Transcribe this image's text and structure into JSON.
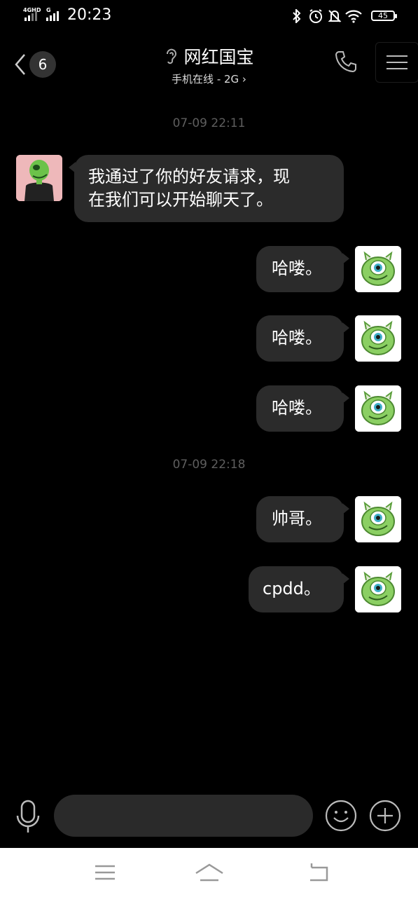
{
  "status_bar": {
    "network_1": "4GHD",
    "network_2": "G",
    "time": "20:23",
    "battery": "45",
    "icons": [
      "bluetooth-icon",
      "alarm-icon",
      "mute-icon",
      "wifi-icon",
      "battery-icon"
    ]
  },
  "header": {
    "back_count": "6",
    "title": "网红国宝",
    "subtitle": "手机在线 - 2G ›",
    "icons": [
      "chevron-left-icon",
      "ear-icon",
      "phone-icon",
      "menu-icon"
    ]
  },
  "messages": {
    "timestamp_1": "07-09 22:11",
    "m1_line1": "我通过了你的好友请求，现",
    "m1_line2": "在我们可以开始聊天了。",
    "m2": "哈喽。",
    "m3": "哈喽。",
    "m4": "哈喽。",
    "timestamp_2": "07-09 22:18",
    "m5": "帅哥。",
    "m6": "cpdd。"
  },
  "input_bar": {
    "placeholder": "",
    "icons": [
      "microphone-icon",
      "emoji-icon",
      "plus-icon"
    ]
  },
  "colors": {
    "background": "#000000",
    "bubble": "#2b2b2b",
    "timestamp": "#5e5e5e",
    "avatar_bg_friend": "#eeb8ba",
    "avatar_green": "#8bcf63"
  }
}
